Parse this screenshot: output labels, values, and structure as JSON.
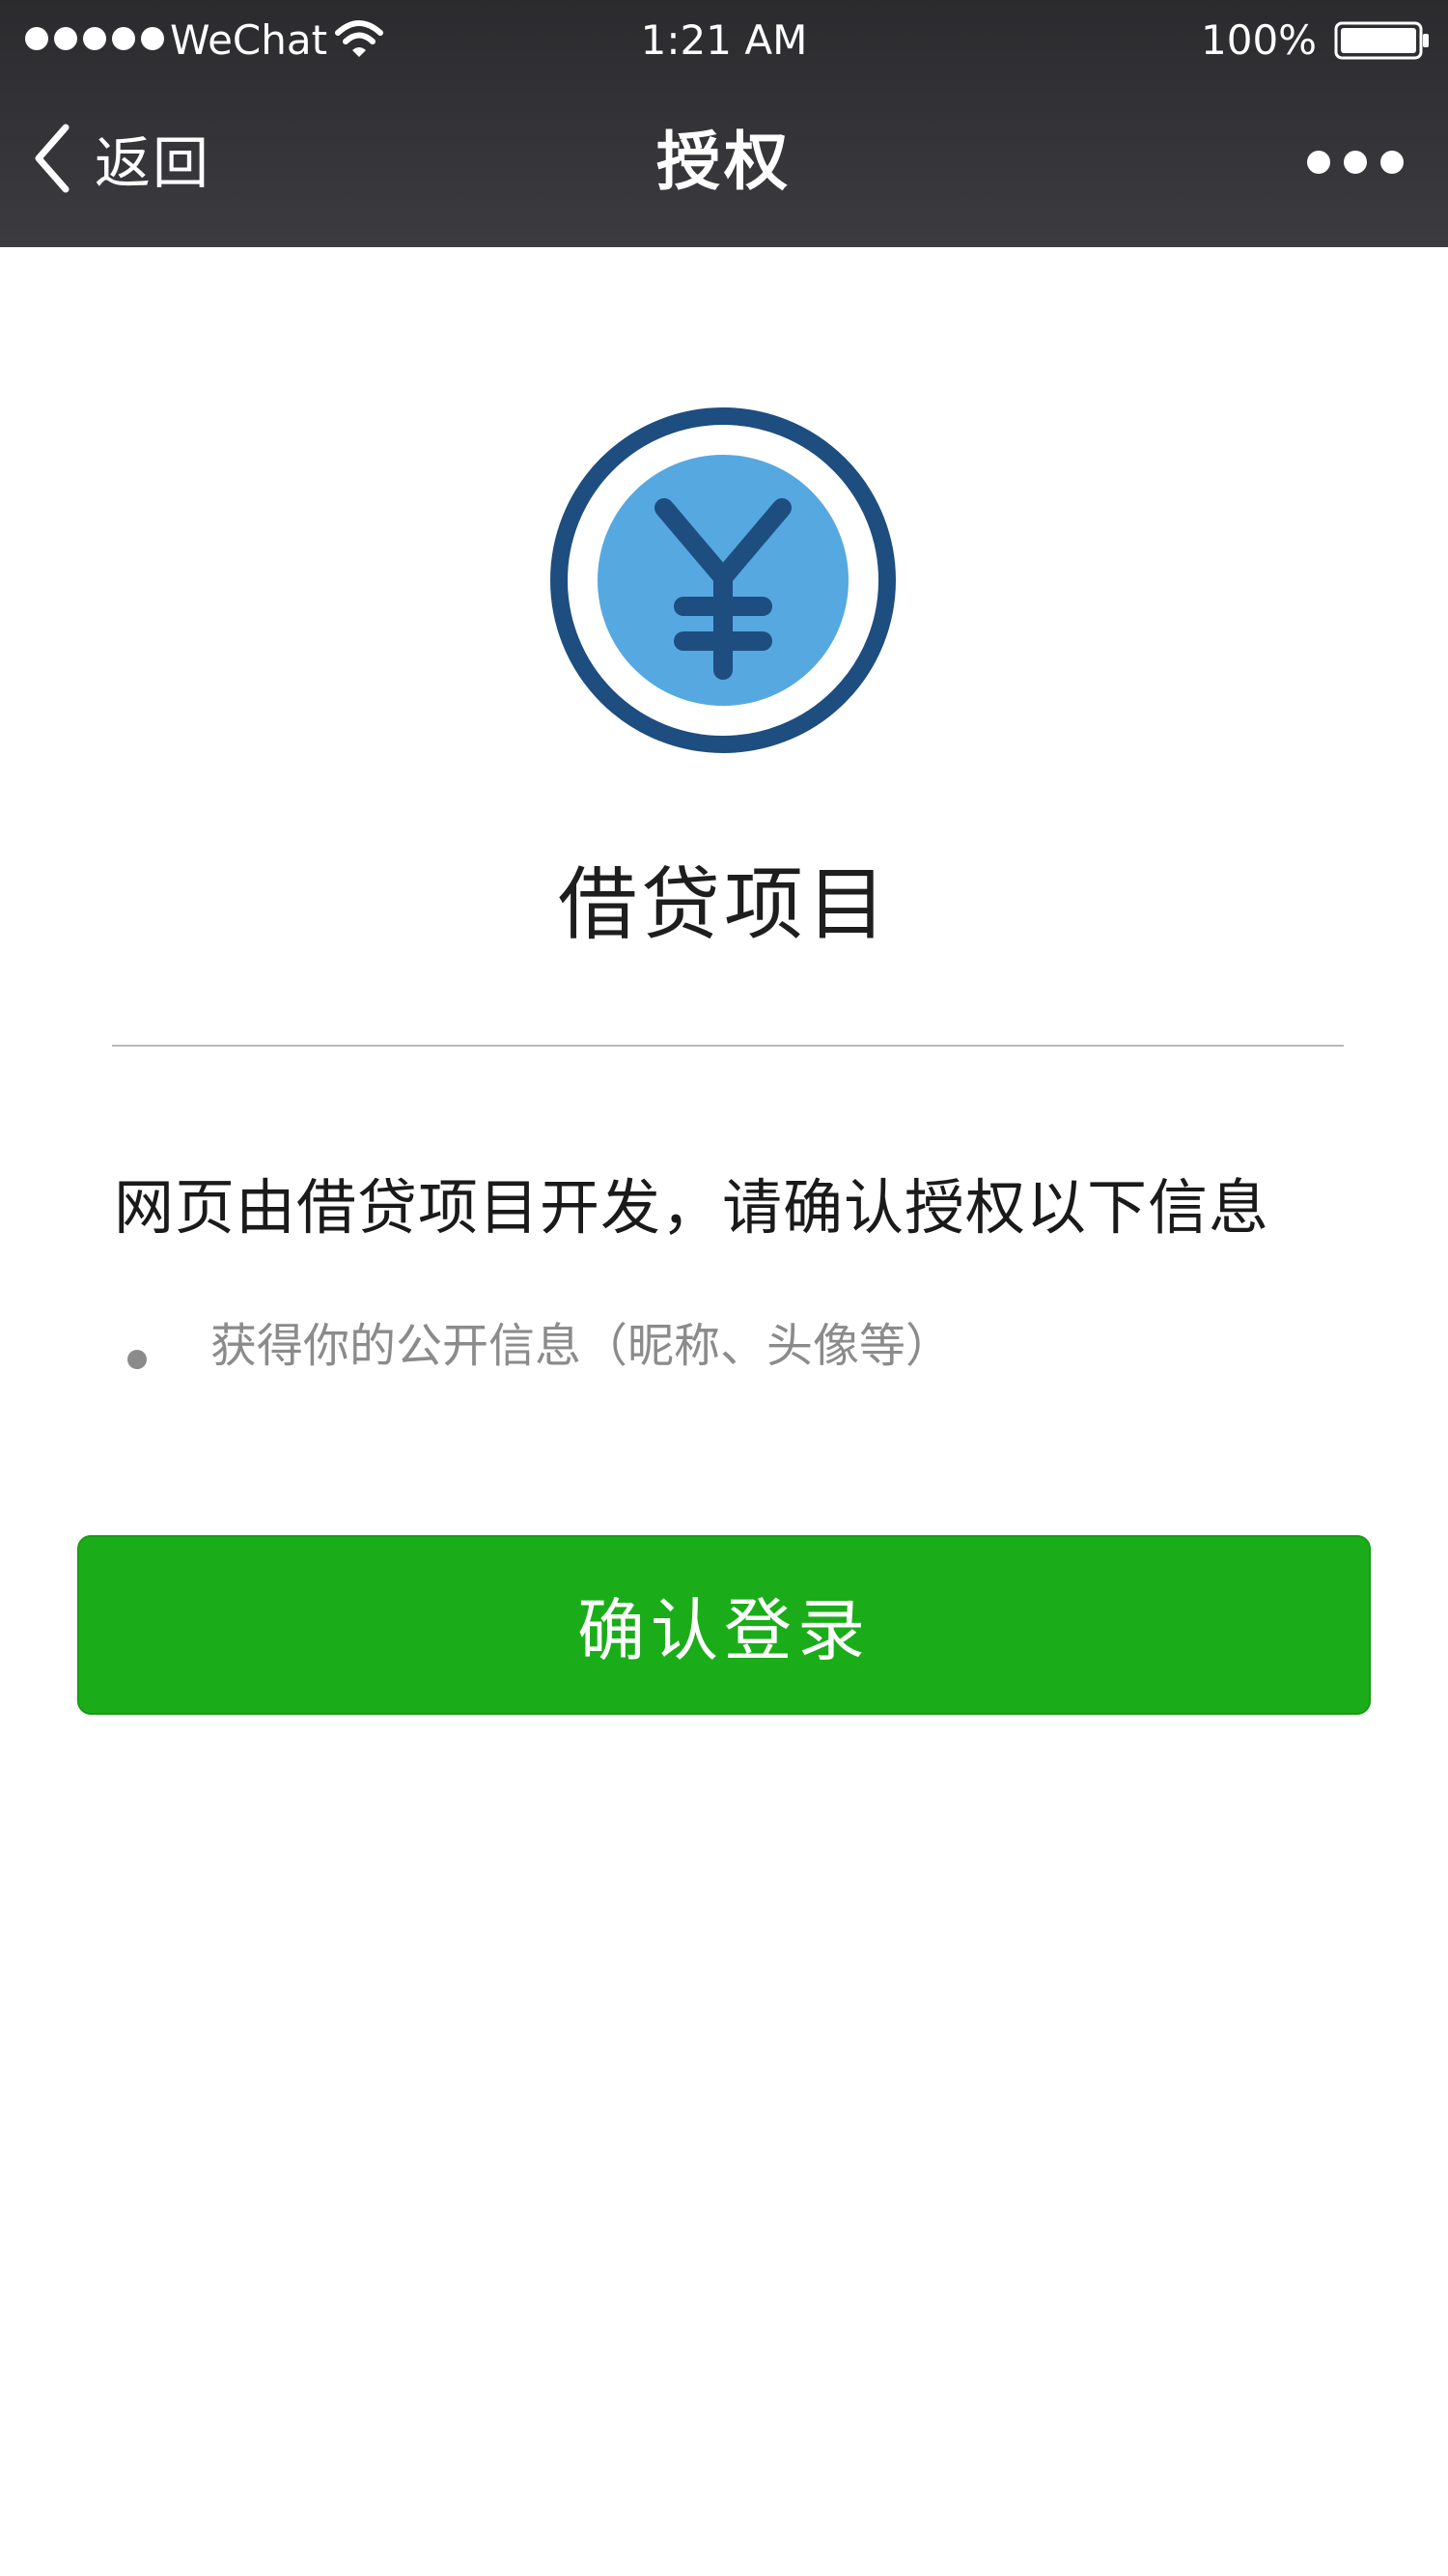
{
  "status_bar": {
    "carrier": "WeChat",
    "time": "1:21 AM",
    "battery": "100%",
    "icons": [
      "signal-dots-icon",
      "wifi-icon",
      "battery-icon"
    ]
  },
  "nav": {
    "back_label": "返回",
    "title": "授权",
    "icons": [
      "chevron-left-icon",
      "more-icon"
    ]
  },
  "app": {
    "name": "借贷项目",
    "logo_icon": "yuan-coin-icon",
    "colors": {
      "ring": "#1e4d80",
      "coin": "#56a8e0"
    }
  },
  "auth": {
    "heading": "网页由借贷项目开发，请确认授权以下信息",
    "permissions": [
      "获得你的公开信息（昵称、头像等）"
    ]
  },
  "confirm": {
    "label": "确认登录",
    "color": "#1aad19"
  }
}
